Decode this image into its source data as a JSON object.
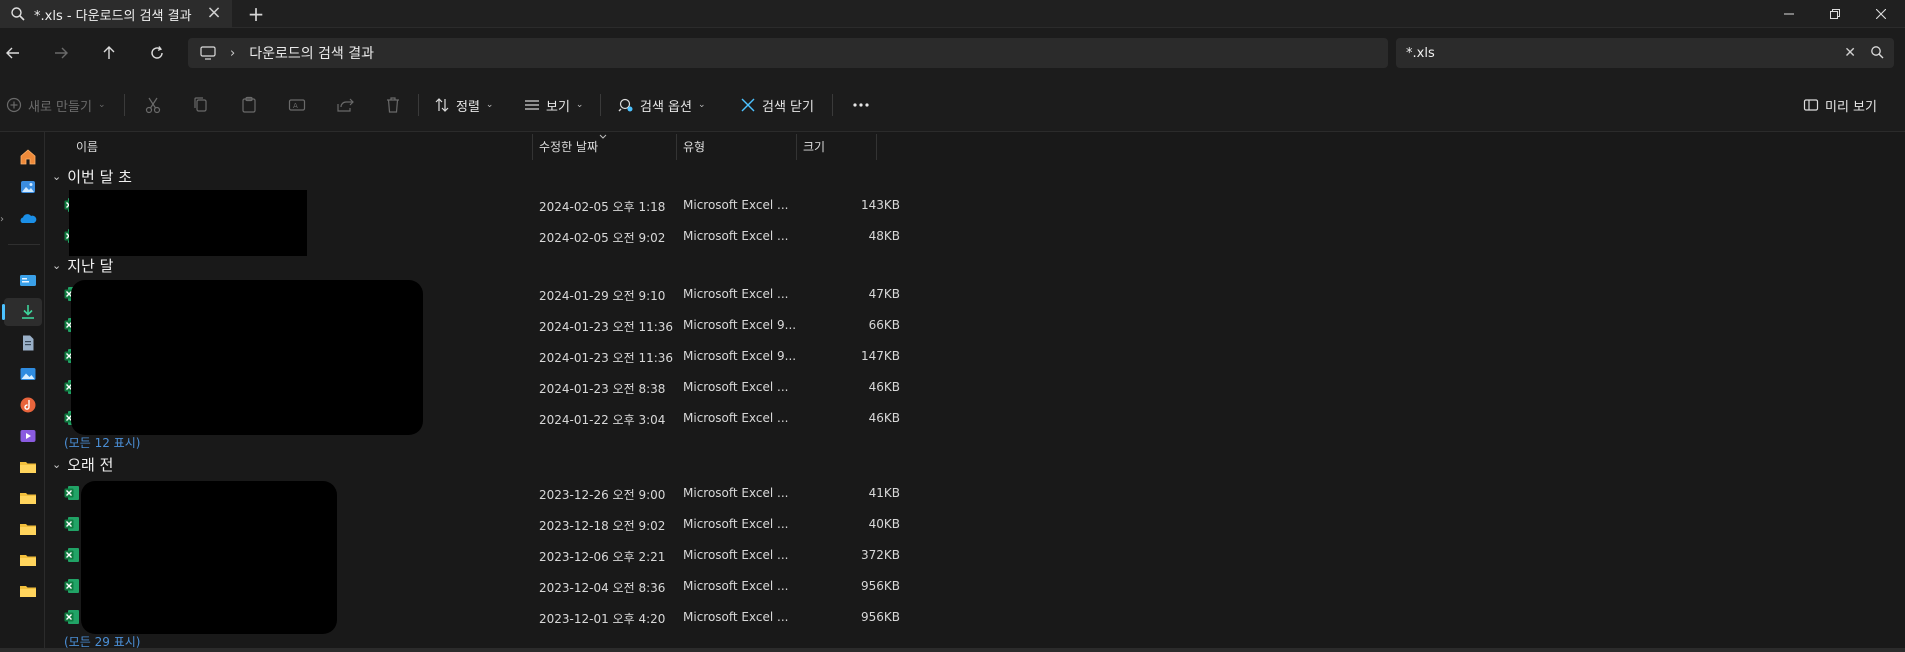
{
  "window": {
    "tab_title": "*.xls - 다운로드의 검색 결과"
  },
  "nav": {
    "breadcrumb": "다운로드의 검색 결과",
    "search_value": "*.xls"
  },
  "toolbar": {
    "new_label": "새로 만들기",
    "sort_label": "정렬",
    "view_label": "보기",
    "search_options_label": "검색 옵션",
    "close_search_label": "검색 닫기",
    "more_label": "...",
    "preview_label": "미리 보기"
  },
  "columns": {
    "name": "이름",
    "date": "수정한 날짜",
    "type": "유형",
    "size": "크기"
  },
  "groups": [
    {
      "label": "이번 달 초",
      "rows": [
        {
          "date": "2024-02-05 오후 1:18",
          "type": "Microsoft Excel ...",
          "size": "143KB"
        },
        {
          "date": "2024-02-05 오전 9:02",
          "type": "Microsoft Excel ...",
          "size": "48KB"
        }
      ]
    },
    {
      "label": "지난 달",
      "rows": [
        {
          "date": "2024-01-29 오전 9:10",
          "type": "Microsoft Excel ...",
          "size": "47KB"
        },
        {
          "date": "2024-01-23 오전 11:36",
          "type": "Microsoft Excel 9...",
          "size": "66KB"
        },
        {
          "date": "2024-01-23 오전 11:36",
          "type": "Microsoft Excel 9...",
          "size": "147KB"
        },
        {
          "date": "2024-01-23 오전 8:38",
          "type": "Microsoft Excel ...",
          "size": "46KB"
        },
        {
          "date": "2024-01-22 오후 3:04",
          "type": "Microsoft Excel ...",
          "size": "46KB"
        }
      ],
      "show_all": "(모든 12 표시)"
    },
    {
      "label": "오래 전",
      "rows": [
        {
          "date": "2023-12-26 오전 9:00",
          "type": "Microsoft Excel ...",
          "size": "41KB"
        },
        {
          "date": "2023-12-18 오전 9:02",
          "type": "Microsoft Excel ...",
          "size": "40KB"
        },
        {
          "date": "2023-12-06 오후 2:21",
          "type": "Microsoft Excel ...",
          "size": "372KB"
        },
        {
          "date": "2023-12-04 오전 8:36",
          "type": "Microsoft Excel ...",
          "size": "956KB"
        },
        {
          "date": "2023-12-01 오후 4:20",
          "type": "Microsoft Excel ...",
          "size": "956KB"
        }
      ],
      "show_all": "(모든 29 표시)"
    }
  ],
  "colors": {
    "accent": "#4cc2ff",
    "excel_green": "#1d7a45",
    "link": "#4b8fd6"
  }
}
